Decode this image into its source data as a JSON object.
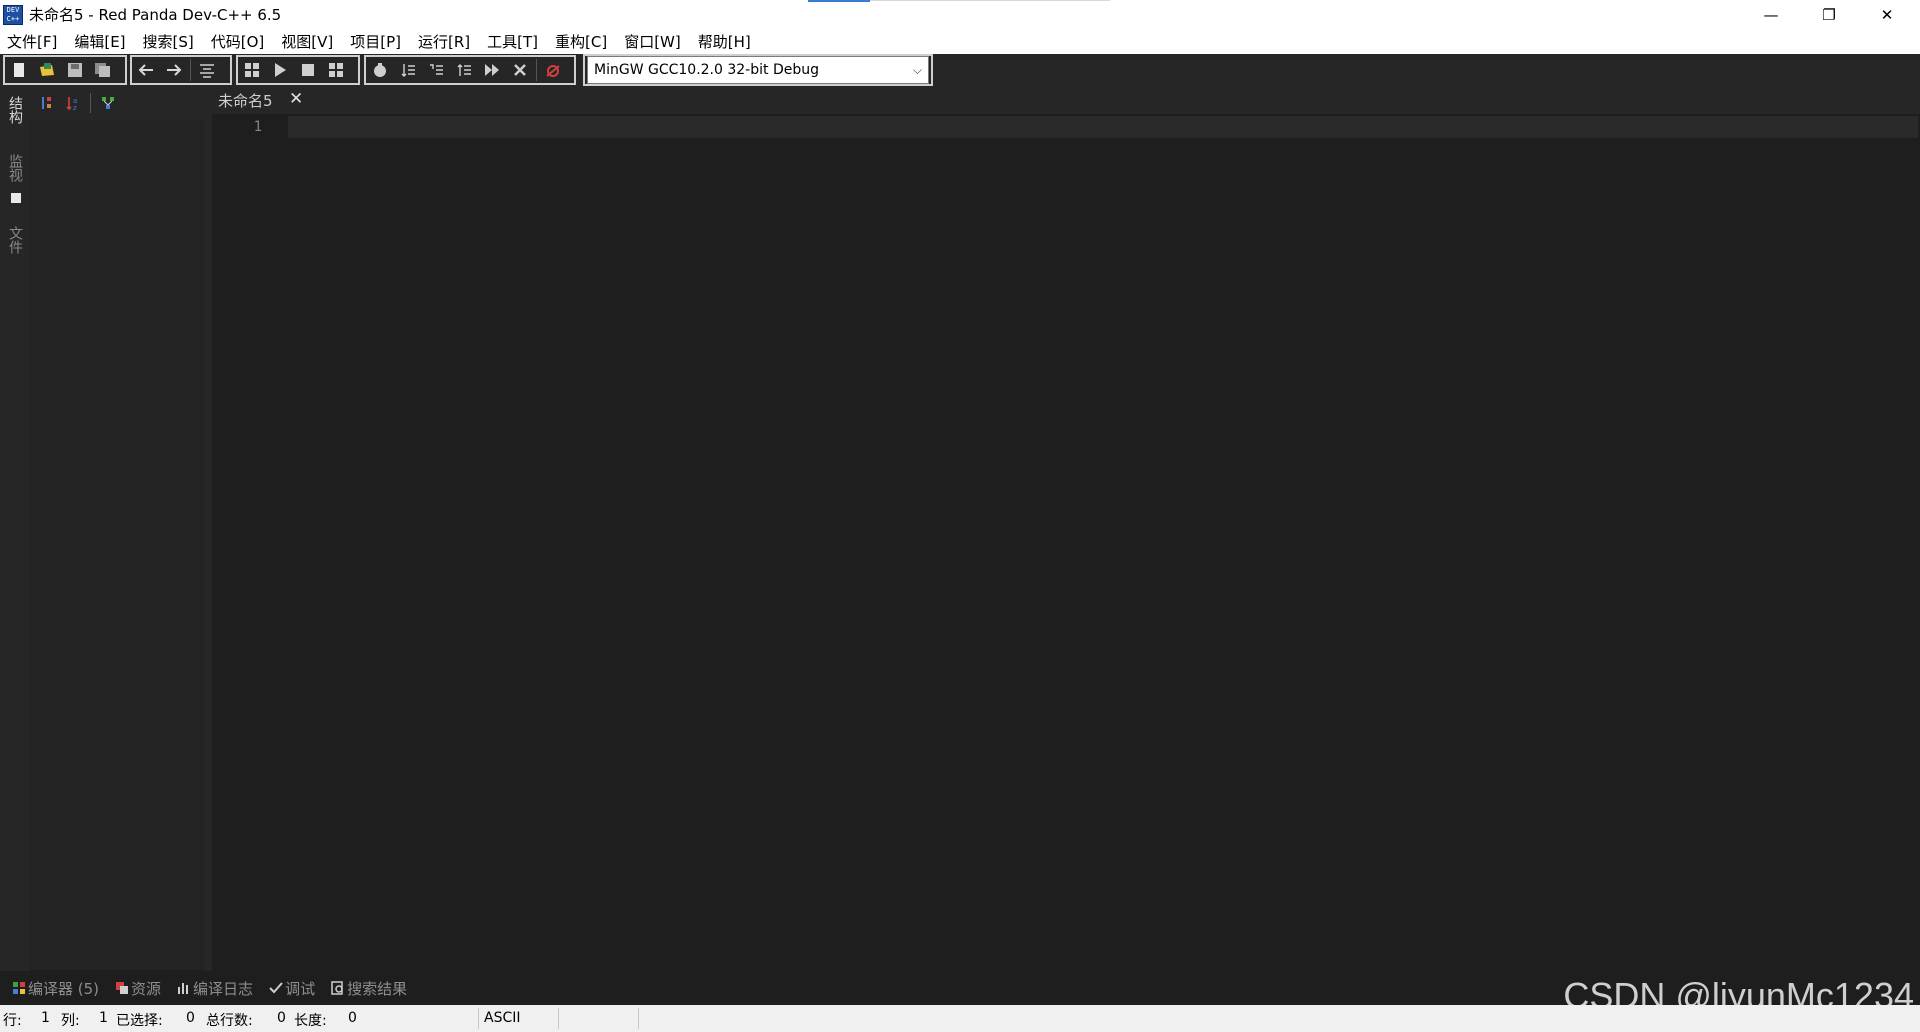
{
  "window": {
    "title": "未命名5 - Red Panda Dev-C++ 6.5",
    "icon_text": "DEV C++",
    "controls": {
      "minimize": "—",
      "maximize": "❐",
      "close": "✕"
    }
  },
  "menu": [
    "文件[F]",
    "编辑[E]",
    "搜索[S]",
    "代码[O]",
    "视图[V]",
    "项目[P]",
    "运行[R]",
    "工具[T]",
    "重构[C]",
    "窗口[W]",
    "帮助[H]"
  ],
  "toolbar": {
    "compiler_select": "MinGW GCC10.2.0 32-bit Debug",
    "groups": [
      [
        "new-file-icon",
        "open-file-icon",
        "save-icon",
        "save-all-icon"
      ],
      [
        "back-icon",
        "forward-icon",
        "format-icon"
      ],
      [
        "compile-icon",
        "run-icon",
        "stop-icon",
        "rebuild-icon"
      ],
      [
        "debug-icon",
        "step-over-icon",
        "step-into-icon",
        "step-out-icon",
        "continue-icon",
        "stop-debug-icon"
      ],
      [
        "close-debug-icon"
      ]
    ]
  },
  "left_tabs": [
    "结构",
    "监视",
    "文件"
  ],
  "editor": {
    "tabs": [
      {
        "label": "未命名5",
        "close": "✕"
      }
    ],
    "lines": [
      "1"
    ]
  },
  "bottom_tabs": [
    {
      "icon": "compiler-icon",
      "label": "编译器 (5)"
    },
    {
      "icon": "resource-icon",
      "label": "资源"
    },
    {
      "icon": "compile-log-icon",
      "label": "编译日志"
    },
    {
      "icon": "debug-check-icon",
      "label": "调试"
    },
    {
      "icon": "search-result-icon",
      "label": "搜索结果"
    }
  ],
  "watermark": "CSDN @liyunMc1234",
  "status": {
    "row_label": "行:",
    "row": "1",
    "col_label": "列:",
    "col": "1",
    "selected_label": "已选择:",
    "selected": "0",
    "total_lines_label": "总行数:",
    "total_lines": "0",
    "length_label": "长度:",
    "length": "0",
    "encoding": "ASCII"
  }
}
